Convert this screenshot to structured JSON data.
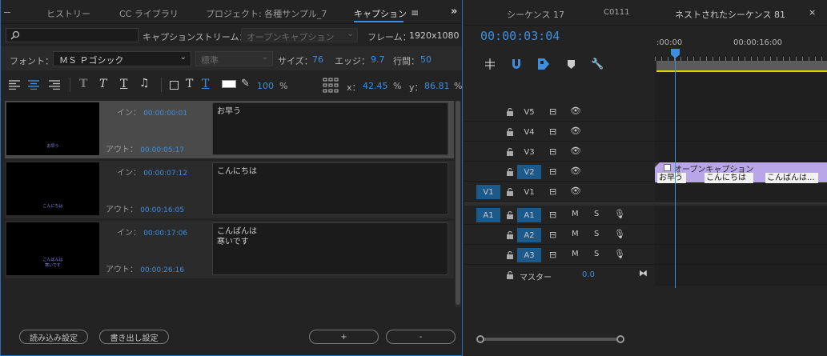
{
  "left_tabs": [
    "ヒストリー",
    "CC ライブラリ",
    "プロジェクト: 各種サンプル_7",
    "キャプション"
  ],
  "caption_panel": {
    "search_placeholder": "",
    "stream_label": "キャプションストリーム：",
    "stream_value": "オープンキャプション",
    "frame_label": "フレーム：",
    "frame_value": "1920x1080",
    "font_label": "フォント：",
    "font_value": "ＭＳ Ｐゴシック",
    "style_value": "標準",
    "size_label": "サイズ：",
    "size_value": "76",
    "edge_label": "エッジ：",
    "edge_value": "9.7",
    "line_label": "行間：",
    "line_value": "50",
    "opacity_value": "100",
    "percent": "%",
    "x_label": "x：",
    "x_value": "42.45",
    "y_label": "y：",
    "y_value": "86.81",
    "in_label": "イン：",
    "out_label": "アウト：",
    "items": [
      {
        "thumb_text": "お早う",
        "in": "00:00:00:01",
        "out": "00:00:05:17",
        "text": "お早う"
      },
      {
        "thumb_text": "こんにちは",
        "in": "00:00:07:12",
        "out": "00:00:16:05",
        "text": "こんにちは"
      },
      {
        "thumb_text": "こんばんは\n寒いです",
        "in": "00:00:17:06",
        "out": "00:00:26:16",
        "text": "こんばんは\n寒いです"
      }
    ],
    "import_button": "読み込み設定",
    "export_button": "書き出し設定",
    "add_button": "+",
    "remove_button": "-"
  },
  "right_tabs": [
    "シーケンス 17",
    "C0111",
    "ネストされたシーケンス 81"
  ],
  "timeline": {
    "timecode": "00:00:03:04",
    "ruler_start": ":00:00",
    "ruler_mid": "00:00:16:00",
    "video_tracks": [
      "V5",
      "V4",
      "V3",
      "V2",
      "V1"
    ],
    "source_video": "V1",
    "audio_tracks": [
      "A1",
      "A2",
      "A3"
    ],
    "source_audio": "A1",
    "mute": "M",
    "solo": "S",
    "master_label": "マスター",
    "master_value": "0.0",
    "clip_header": "オープンキャプション",
    "clips": [
      "お早う",
      "こんにちは",
      "こんばんは..."
    ]
  },
  "colors": {
    "accent": "#3f8ede",
    "panel_border": "#2b6db3",
    "track_on": "#1d5a8c",
    "clip": "#b9a6e8"
  }
}
